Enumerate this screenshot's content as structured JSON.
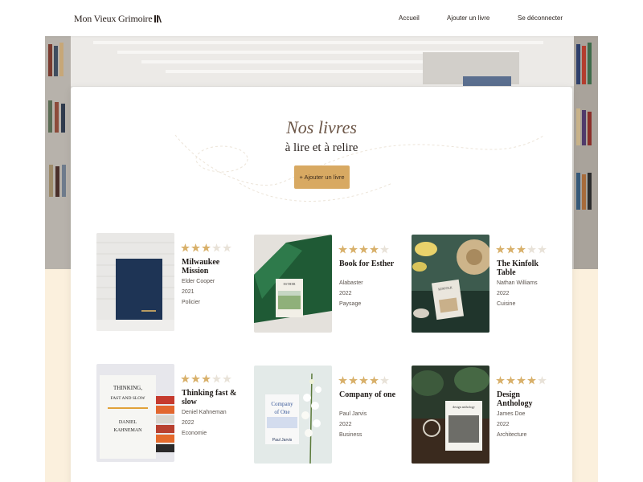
{
  "header": {
    "logo_text": "Mon Vieux Grimoire",
    "nav": [
      "Accueil",
      "Ajouter un livre",
      "Se déconnecter"
    ]
  },
  "hero": {
    "title": "Nos livres",
    "subtitle": "à lire et à relire",
    "add_button": "+ Ajouter un livre"
  },
  "books": [
    {
      "title": "Milwaukee Mission",
      "author": "Elder Cooper",
      "year": "2021",
      "genre": "Policier",
      "rating": 3
    },
    {
      "title": "Book for Esther",
      "author": "Alabaster",
      "year": "2022",
      "genre": "Paysage",
      "rating": 4
    },
    {
      "title": "The Kinfolk Table",
      "author": "Nathan Williams",
      "year": "2022",
      "genre": "Cuisine",
      "rating": 3
    },
    {
      "title": "Thinking fast & slow",
      "author": "Deniel Kahneman",
      "year": "2022",
      "genre": "Economie",
      "rating": 3
    },
    {
      "title": "Company of one",
      "author": "Paul Jarvis",
      "year": "2022",
      "genre": "Business",
      "rating": 4
    },
    {
      "title": "Design Anthology",
      "author": "James Doe",
      "year": "2022",
      "genre": "Architecture",
      "rating": 4
    }
  ],
  "cover_text": {
    "esther": "ESTHER",
    "kinfolk": "KINFOLK",
    "thinking": [
      "THINKING,",
      "FAST AND SLOW",
      "DANIEL",
      "KAHNEMAN"
    ],
    "company": [
      "Company",
      "of One",
      "Paul Jarvis"
    ],
    "anthology": "design anthology"
  },
  "colors": {
    "accent": "#d8a962",
    "title_brown": "#6b5546",
    "star_filled": "#d8b06a",
    "star_empty": "#e8e2d8",
    "page_bottom": "#fbf0dd"
  }
}
